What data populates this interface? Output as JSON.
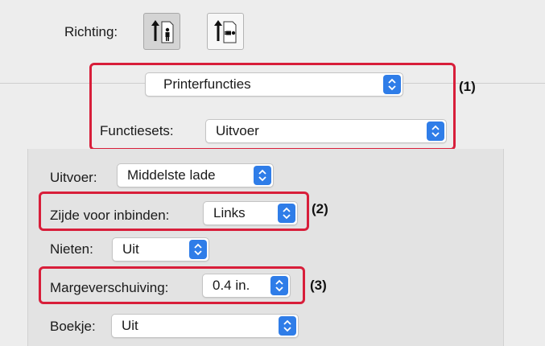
{
  "orientation": {
    "label": "Richting:",
    "options": [
      {
        "name": "portrait",
        "selected": true
      },
      {
        "name": "landscape",
        "selected": false
      }
    ]
  },
  "panel_select": {
    "value": "Printerfuncties"
  },
  "function_sets": {
    "label": "Functiesets:",
    "value": "Uitvoer"
  },
  "output": {
    "label": "Uitvoer:",
    "value": "Middelste lade"
  },
  "binding_edge": {
    "label": "Zijde voor inbinden:",
    "value": "Links"
  },
  "stapling": {
    "label": "Nieten:",
    "value": "Uit"
  },
  "margin_shift": {
    "label": "Margeverschuiving:",
    "value": "0.4 in."
  },
  "booklet": {
    "label": "Boekje:",
    "value": "Uit"
  },
  "callouts": {
    "one": "(1)",
    "two": "(2)",
    "three": "(3)"
  },
  "colors": {
    "accent": "#2f7de8",
    "highlight": "#d81e3a",
    "background": "#ededed"
  }
}
